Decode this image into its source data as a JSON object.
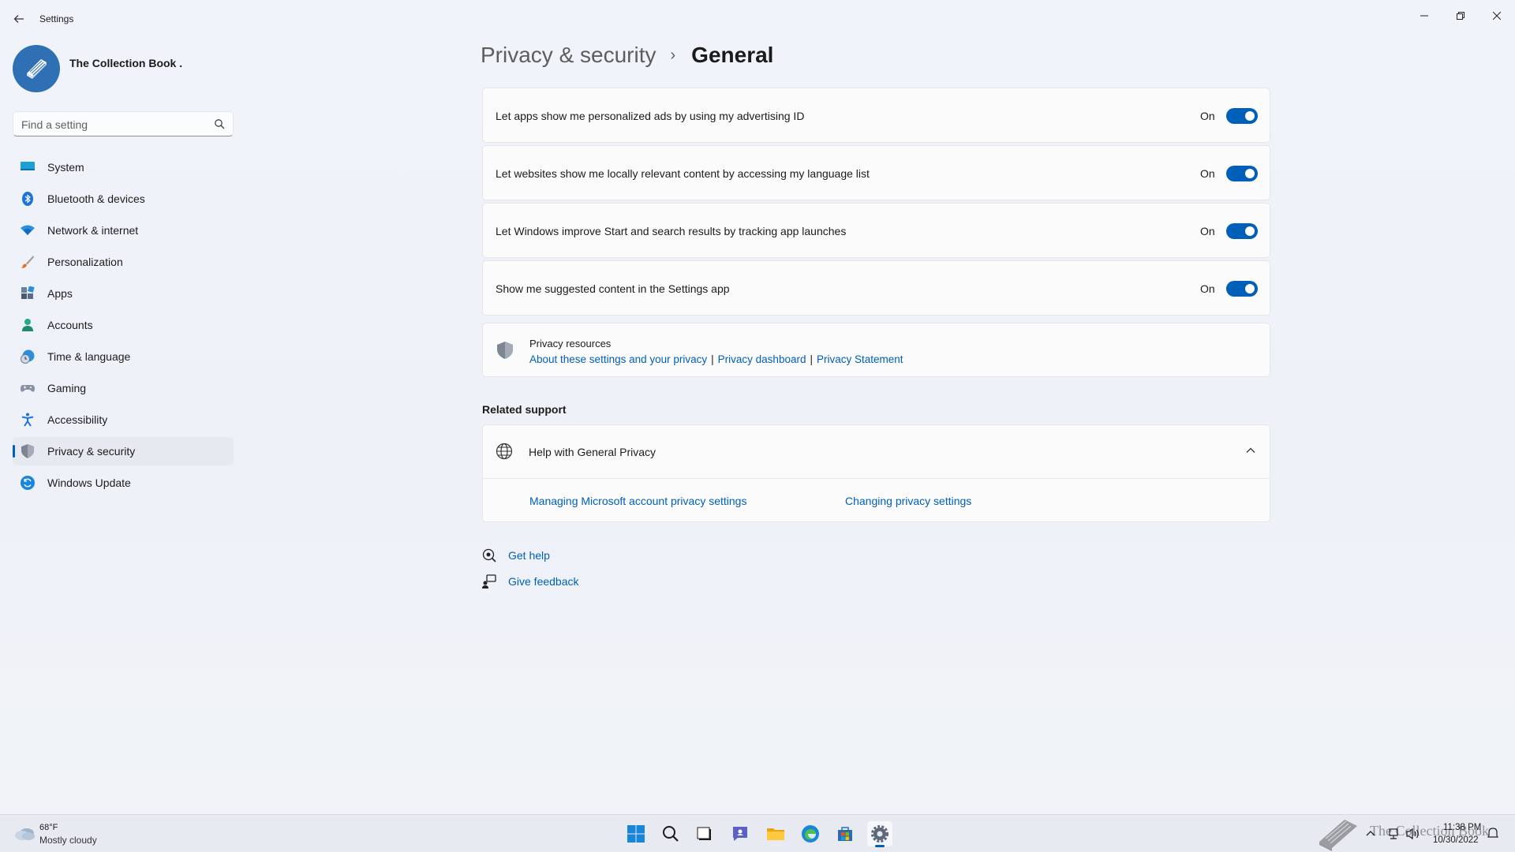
{
  "app": {
    "title": "Settings"
  },
  "profile": {
    "name": "The Collection Book ."
  },
  "search": {
    "placeholder": "Find a setting"
  },
  "nav": {
    "items": [
      {
        "label": "System",
        "icon": "monitor-icon"
      },
      {
        "label": "Bluetooth & devices",
        "icon": "bluetooth-icon"
      },
      {
        "label": "Network & internet",
        "icon": "wifi-icon"
      },
      {
        "label": "Personalization",
        "icon": "paintbrush-icon"
      },
      {
        "label": "Apps",
        "icon": "apps-icon"
      },
      {
        "label": "Accounts",
        "icon": "person-icon"
      },
      {
        "label": "Time & language",
        "icon": "clock-globe-icon"
      },
      {
        "label": "Gaming",
        "icon": "gamepad-icon"
      },
      {
        "label": "Accessibility",
        "icon": "accessibility-icon"
      },
      {
        "label": "Privacy & security",
        "icon": "shield-icon",
        "active": true
      },
      {
        "label": "Windows Update",
        "icon": "update-icon"
      }
    ]
  },
  "breadcrumb": {
    "parent": "Privacy & security",
    "separator": "›",
    "current": "General"
  },
  "settings": [
    {
      "label": "Let apps show me personalized ads by using my advertising ID",
      "state": "On",
      "enabled": true
    },
    {
      "label": "Let websites show me locally relevant content by accessing my language list",
      "state": "On",
      "enabled": true
    },
    {
      "label": "Let Windows improve Start and search results by tracking app launches",
      "state": "On",
      "enabled": true
    },
    {
      "label": "Show me suggested content in the Settings app",
      "state": "On",
      "enabled": true
    }
  ],
  "privacy_resources": {
    "title": "Privacy resources",
    "links": [
      "About these settings and your privacy",
      "Privacy dashboard",
      "Privacy Statement"
    ],
    "separator": "|"
  },
  "related_support": {
    "title": "Related support",
    "help": {
      "title": "Help with General Privacy",
      "links": [
        "Managing Microsoft account privacy settings",
        "Changing privacy settings"
      ]
    }
  },
  "footer_links": {
    "get_help": "Get help",
    "give_feedback": "Give feedback"
  },
  "taskbar": {
    "weather": {
      "temp": "68°F",
      "desc": "Mostly cloudy"
    },
    "time": "11:38 PM",
    "date": "10/30/2022",
    "watermark": "The Collection Book"
  },
  "colors": {
    "accent": "#005fb8",
    "background": "#eef2f8"
  }
}
